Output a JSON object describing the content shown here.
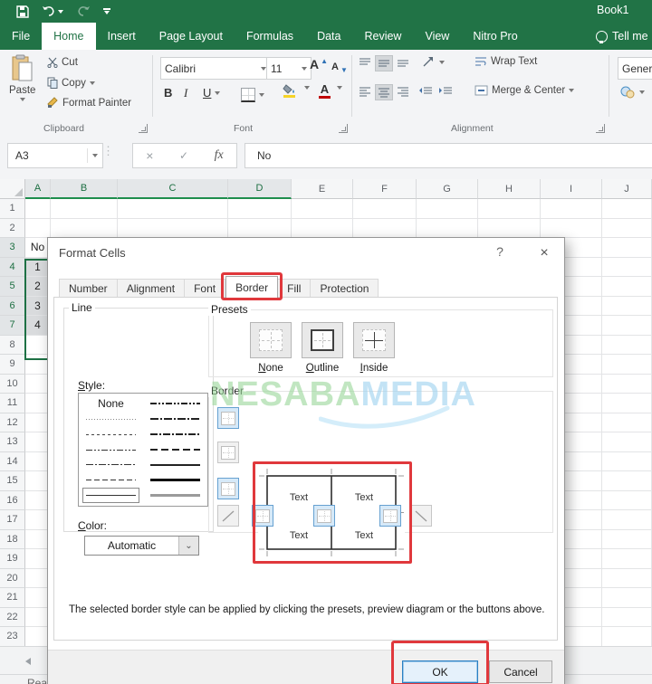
{
  "titlebar": {
    "doc_title": "Book1"
  },
  "ribbon_tabs": {
    "tabs": [
      "File",
      "Home",
      "Insert",
      "Page Layout",
      "Formulas",
      "Data",
      "Review",
      "View",
      "Nitro Pro"
    ],
    "active": "Home",
    "tell_me": "Tell me"
  },
  "ribbon": {
    "clipboard": {
      "group_label": "Clipboard",
      "paste": "Paste",
      "cut": "Cut",
      "copy": "Copy",
      "format_painter": "Format Painter"
    },
    "font": {
      "group_label": "Font",
      "font_name": "Calibri",
      "font_size": "11",
      "bold": "B",
      "italic": "I",
      "underline": "U"
    },
    "alignment": {
      "group_label": "Alignment",
      "wrap_text": "Wrap Text",
      "merge_center": "Merge & Center"
    },
    "number": {
      "format": "General"
    }
  },
  "formula_bar": {
    "name_box": "A3",
    "value": "No",
    "icons": {
      "cancel": "×",
      "enter": "✓",
      "function": "fx"
    }
  },
  "grid": {
    "columns": [
      "A",
      "B",
      "C",
      "D",
      "E",
      "F",
      "G",
      "H",
      "I",
      "J"
    ],
    "row_count": 23,
    "selected_columns": [
      "A",
      "B",
      "C",
      "D"
    ],
    "selected_rows": [
      3,
      4,
      5,
      6,
      7
    ],
    "cells": {
      "A3": "No",
      "A4": "1",
      "A5": "2",
      "A6": "3",
      "A7": "4"
    },
    "selection": {
      "active": "A3",
      "filled": [
        "A4",
        "A5",
        "A6",
        "A7"
      ]
    }
  },
  "status_bar": {
    "text": "Ready"
  },
  "dialog": {
    "title": "Format Cells",
    "icons": {
      "help": "?",
      "close": "×"
    },
    "tabs": [
      "Number",
      "Alignment",
      "Font",
      "Border",
      "Fill",
      "Protection"
    ],
    "active_tab": "Border",
    "line": {
      "group_label": "Line",
      "style_label": "Style:",
      "none_label": "None",
      "styles_left": [
        "none",
        "hair",
        "dotted",
        "dashdotdot",
        "dashdot",
        "dashed",
        "thin"
      ],
      "styles_right": [
        "mdashdotdot",
        "slantdashdot",
        "mdashdot",
        "mdashed",
        "medium",
        "thick",
        "double"
      ],
      "selected_style": "thin",
      "color_label": "Color:",
      "color_value": "Automatic"
    },
    "presets": {
      "group_label": "Presets",
      "items": [
        {
          "label": "None",
          "key": "none"
        },
        {
          "label": "Outline",
          "key": "outline"
        },
        {
          "label": "Inside",
          "key": "inside"
        }
      ]
    },
    "border": {
      "group_label": "Border",
      "text_sample": "Text",
      "left_buttons": [
        {
          "name": "top",
          "active": true
        },
        {
          "name": "inner-horizontal",
          "active": false
        },
        {
          "name": "bottom",
          "active": true
        }
      ],
      "bottom_buttons": [
        {
          "name": "diagonal-up",
          "active": false
        },
        {
          "name": "left",
          "active": true
        },
        {
          "name": "inner-vertical",
          "active": true
        },
        {
          "name": "right",
          "active": true
        },
        {
          "name": "diagonal-down",
          "active": false
        }
      ]
    },
    "description": "The selected border style can be applied by clicking the presets, preview diagram or the buttons above.",
    "ok": "OK",
    "cancel": "Cancel",
    "watermark": {
      "part1": "NESABA",
      "part2": "MEDIA",
      "color1": "#9cd89c",
      "color2": "#9fd3f0"
    }
  },
  "annotation_color": "#e0383c"
}
